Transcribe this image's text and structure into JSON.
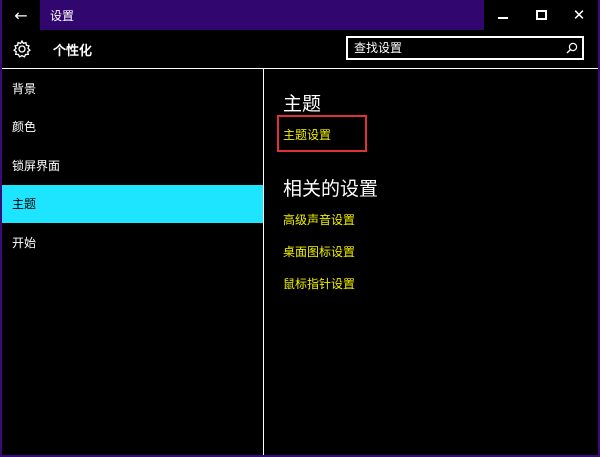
{
  "window": {
    "title": "设置"
  },
  "header": {
    "page_title": "个性化",
    "search": {
      "placeholder": "查找设置"
    }
  },
  "sidebar": {
    "items": [
      {
        "label": "背景",
        "active": false
      },
      {
        "label": "颜色",
        "active": false
      },
      {
        "label": "锁屏界面",
        "active": false
      },
      {
        "label": "主题",
        "active": true
      },
      {
        "label": "开始",
        "active": false
      }
    ]
  },
  "content": {
    "theme_heading": "主题",
    "theme_settings_link": "主题设置",
    "related_heading": "相关的设置",
    "related_links": [
      "高级声音设置",
      "桌面图标设置",
      "鼠标指针设置"
    ]
  },
  "colors": {
    "accent": "#1ee5ff",
    "title_strip": "#32066f",
    "link": "#f0f000",
    "highlight": "#e0303a"
  },
  "icons": {
    "back": "back-arrow-icon",
    "settings": "gear-icon",
    "search": "search-icon",
    "minimize": "minimize-icon",
    "maximize": "maximize-icon",
    "close": "close-icon"
  }
}
